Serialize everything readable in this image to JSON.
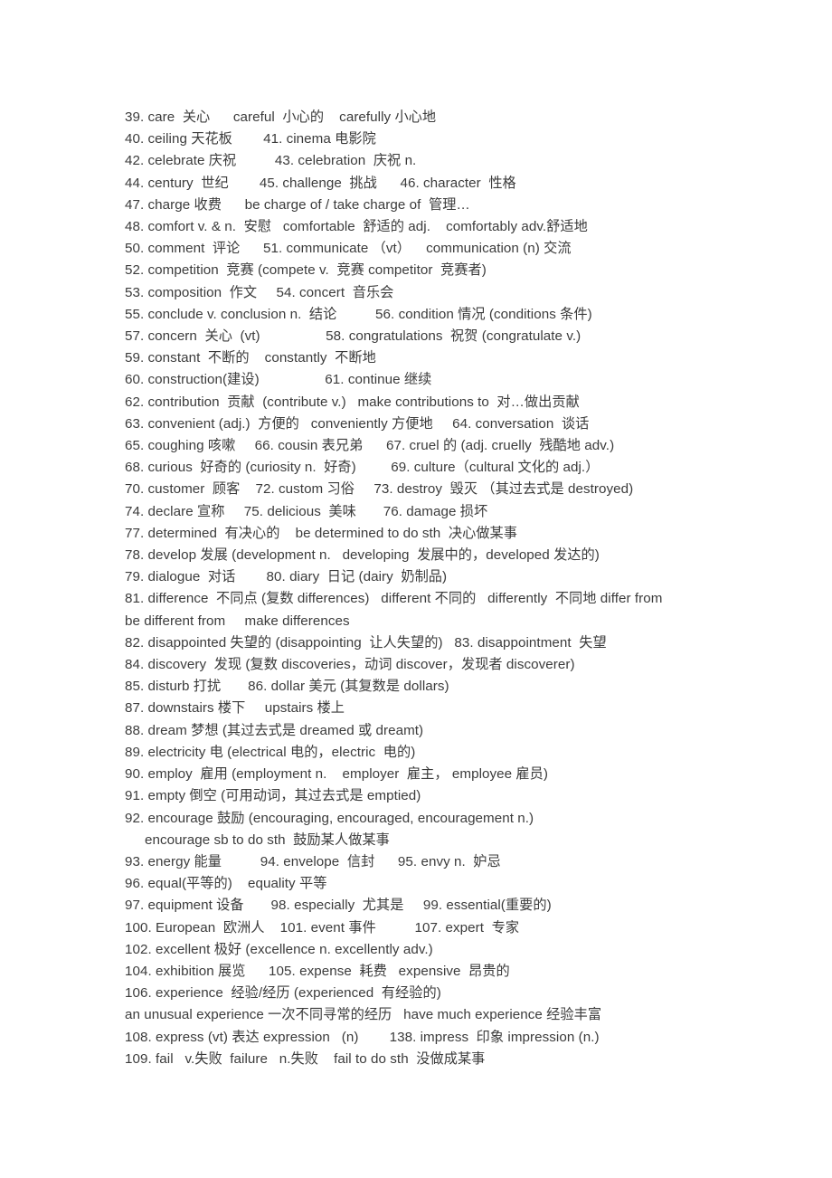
{
  "document": {
    "type": "vocabulary-word-list",
    "page_background": "#ffffff",
    "text_color": "#3b3b3b",
    "entries": [
      {
        "id": "line-39",
        "text": "39. care  关心      careful  小心的    carefully 小心地"
      },
      {
        "id": "line-40",
        "text": "40. ceiling 天花板        41. cinema 电影院"
      },
      {
        "id": "line-42",
        "text": "42. celebrate 庆祝          43. celebration  庆祝 n."
      },
      {
        "id": "line-44",
        "text": "44. century  世纪        45. challenge  挑战      46. character  性格"
      },
      {
        "id": "line-47",
        "text": "47. charge 收费      be charge of / take charge of  管理…"
      },
      {
        "id": "line-48",
        "text": "48. comfort v. & n.  安慰   comfortable  舒适的 adj.    comfortably adv.舒适地"
      },
      {
        "id": "line-50",
        "text": "50. comment  评论      51. communicate （vt）    communication (n) 交流"
      },
      {
        "id": "line-52",
        "text": "52. competition  竞赛 (compete v.  竞赛 competitor  竞赛者)"
      },
      {
        "id": "line-53",
        "text": "53. composition  作文     54. concert  音乐会"
      },
      {
        "id": "line-55",
        "text": "55. conclude v. conclusion n.  结论          56. condition 情况 (conditions 条件)"
      },
      {
        "id": "line-57",
        "text": "57. concern  关心  (vt)                 58. congratulations  祝贺 (congratulate v.)"
      },
      {
        "id": "line-59",
        "text": "59. constant  不断的    constantly  不断地"
      },
      {
        "id": "line-60",
        "text": "60. construction(建设)                 61. continue 继续"
      },
      {
        "id": "line-62",
        "text": "62. contribution  贡献  (contribute v.)   make contributions to  对…做出贡献"
      },
      {
        "id": "line-63",
        "text": "63. convenient (adj.)  方便的   conveniently 方便地     64. conversation  谈话"
      },
      {
        "id": "line-65",
        "text": "65. coughing 咳嗽     66. cousin 表兄弟      67. cruel 的 (adj. cruelly  残酷地 adv.)"
      },
      {
        "id": "line-68",
        "text": "68. curious  好奇的 (curiosity n.  好奇)         69. culture（cultural 文化的 adj.）"
      },
      {
        "id": "line-70",
        "text": "70. customer  顾客    72. custom 习俗     73. destroy  毁灭 （其过去式是 destroyed)"
      },
      {
        "id": "line-74",
        "text": "74. declare 宣称     75. delicious  美味       76. damage 损坏"
      },
      {
        "id": "line-77",
        "text": "77. determined  有决心的    be determined to do sth  决心做某事"
      },
      {
        "id": "line-78",
        "text": "78. develop 发展 (development n.   developing  发展中的，developed 发达的)"
      },
      {
        "id": "line-79",
        "text": "79. dialogue  对话        80. diary  日记 (dairy  奶制品)"
      },
      {
        "id": "line-81a",
        "text": "81. difference  不同点 (复数 differences)   different 不同的   differently  不同地 differ from"
      },
      {
        "id": "line-81b",
        "text": "be different from     make differences"
      },
      {
        "id": "line-82",
        "text": "82. disappointed 失望的 (disappointing  让人失望的)   83. disappointment  失望"
      },
      {
        "id": "line-84",
        "text": "84. discovery  发现 (复数 discoveries，动词 discover，发现者 discoverer)"
      },
      {
        "id": "line-85",
        "text": "85. disturb 打扰       86. dollar 美元 (其复数是 dollars)"
      },
      {
        "id": "line-87",
        "text": "87. downstairs 楼下     upstairs 楼上"
      },
      {
        "id": "line-88",
        "text": "88. dream 梦想 (其过去式是 dreamed 或 dreamt)"
      },
      {
        "id": "line-89",
        "text": "89. electricity 电 (electrical 电的，electric  电的)"
      },
      {
        "id": "line-90",
        "text": "90. employ  雇用 (employment n.    employer  雇主， employee 雇员)"
      },
      {
        "id": "line-91",
        "text": "91. empty 倒空 (可用动词，其过去式是 emptied)"
      },
      {
        "id": "line-92a",
        "text": "92. encourage 鼓励 (encouraging, encouraged, encouragement n.)"
      },
      {
        "id": "line-92b",
        "text": "encourage sb to do sth  鼓励某人做某事"
      },
      {
        "id": "line-93",
        "text": "93. energy 能量          94. envelope  信封      95. envy n.  妒忌"
      },
      {
        "id": "line-96",
        "text": "96. equal(平等的)    equality 平等"
      },
      {
        "id": "line-97",
        "text": "97. equipment 设备       98. especially  尤其是     99. essential(重要的)"
      },
      {
        "id": "line-100",
        "text": "100. European  欧洲人    101. event 事件          107. expert  专家"
      },
      {
        "id": "line-102",
        "text": "102. excellent 极好 (excellence n. excellently adv.)"
      },
      {
        "id": "line-104",
        "text": "104. exhibition 展览      105. expense  耗费   expensive  昂贵的"
      },
      {
        "id": "line-106",
        "text": "106. experience  经验/经历 (experienced  有经验的)"
      },
      {
        "id": "line-107",
        "text": "an unusual experience 一次不同寻常的经历   have much experience 经验丰富"
      },
      {
        "id": "line-108",
        "text": "108. express (vt) 表达 expression   (n)        138. impress  印象 impression (n.)"
      },
      {
        "id": "line-109",
        "text": "109. fail   v.失败  failure   n.失败    fail to do sth  没做成某事"
      }
    ]
  }
}
